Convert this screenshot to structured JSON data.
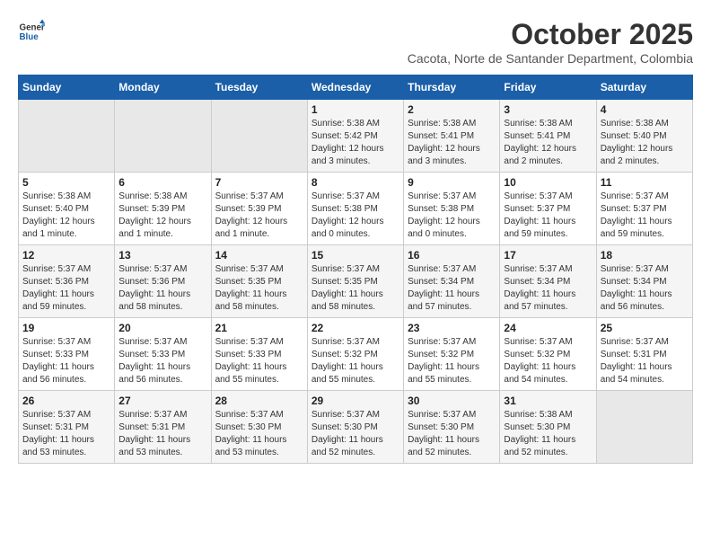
{
  "logo": {
    "general": "General",
    "blue": "Blue"
  },
  "header": {
    "month": "October 2025",
    "subtitle": "Cacota, Norte de Santander Department, Colombia"
  },
  "weekdays": [
    "Sunday",
    "Monday",
    "Tuesday",
    "Wednesday",
    "Thursday",
    "Friday",
    "Saturday"
  ],
  "weeks": [
    [
      {
        "day": "",
        "sunrise": "",
        "sunset": "",
        "daylight": ""
      },
      {
        "day": "",
        "sunrise": "",
        "sunset": "",
        "daylight": ""
      },
      {
        "day": "",
        "sunrise": "",
        "sunset": "",
        "daylight": ""
      },
      {
        "day": "1",
        "sunrise": "Sunrise: 5:38 AM",
        "sunset": "Sunset: 5:42 PM",
        "daylight": "Daylight: 12 hours and 3 minutes."
      },
      {
        "day": "2",
        "sunrise": "Sunrise: 5:38 AM",
        "sunset": "Sunset: 5:41 PM",
        "daylight": "Daylight: 12 hours and 3 minutes."
      },
      {
        "day": "3",
        "sunrise": "Sunrise: 5:38 AM",
        "sunset": "Sunset: 5:41 PM",
        "daylight": "Daylight: 12 hours and 2 minutes."
      },
      {
        "day": "4",
        "sunrise": "Sunrise: 5:38 AM",
        "sunset": "Sunset: 5:40 PM",
        "daylight": "Daylight: 12 hours and 2 minutes."
      }
    ],
    [
      {
        "day": "5",
        "sunrise": "Sunrise: 5:38 AM",
        "sunset": "Sunset: 5:40 PM",
        "daylight": "Daylight: 12 hours and 1 minute."
      },
      {
        "day": "6",
        "sunrise": "Sunrise: 5:38 AM",
        "sunset": "Sunset: 5:39 PM",
        "daylight": "Daylight: 12 hours and 1 minute."
      },
      {
        "day": "7",
        "sunrise": "Sunrise: 5:37 AM",
        "sunset": "Sunset: 5:39 PM",
        "daylight": "Daylight: 12 hours and 1 minute."
      },
      {
        "day": "8",
        "sunrise": "Sunrise: 5:37 AM",
        "sunset": "Sunset: 5:38 PM",
        "daylight": "Daylight: 12 hours and 0 minutes."
      },
      {
        "day": "9",
        "sunrise": "Sunrise: 5:37 AM",
        "sunset": "Sunset: 5:38 PM",
        "daylight": "Daylight: 12 hours and 0 minutes."
      },
      {
        "day": "10",
        "sunrise": "Sunrise: 5:37 AM",
        "sunset": "Sunset: 5:37 PM",
        "daylight": "Daylight: 11 hours and 59 minutes."
      },
      {
        "day": "11",
        "sunrise": "Sunrise: 5:37 AM",
        "sunset": "Sunset: 5:37 PM",
        "daylight": "Daylight: 11 hours and 59 minutes."
      }
    ],
    [
      {
        "day": "12",
        "sunrise": "Sunrise: 5:37 AM",
        "sunset": "Sunset: 5:36 PM",
        "daylight": "Daylight: 11 hours and 59 minutes."
      },
      {
        "day": "13",
        "sunrise": "Sunrise: 5:37 AM",
        "sunset": "Sunset: 5:36 PM",
        "daylight": "Daylight: 11 hours and 58 minutes."
      },
      {
        "day": "14",
        "sunrise": "Sunrise: 5:37 AM",
        "sunset": "Sunset: 5:35 PM",
        "daylight": "Daylight: 11 hours and 58 minutes."
      },
      {
        "day": "15",
        "sunrise": "Sunrise: 5:37 AM",
        "sunset": "Sunset: 5:35 PM",
        "daylight": "Daylight: 11 hours and 58 minutes."
      },
      {
        "day": "16",
        "sunrise": "Sunrise: 5:37 AM",
        "sunset": "Sunset: 5:34 PM",
        "daylight": "Daylight: 11 hours and 57 minutes."
      },
      {
        "day": "17",
        "sunrise": "Sunrise: 5:37 AM",
        "sunset": "Sunset: 5:34 PM",
        "daylight": "Daylight: 11 hours and 57 minutes."
      },
      {
        "day": "18",
        "sunrise": "Sunrise: 5:37 AM",
        "sunset": "Sunset: 5:34 PM",
        "daylight": "Daylight: 11 hours and 56 minutes."
      }
    ],
    [
      {
        "day": "19",
        "sunrise": "Sunrise: 5:37 AM",
        "sunset": "Sunset: 5:33 PM",
        "daylight": "Daylight: 11 hours and 56 minutes."
      },
      {
        "day": "20",
        "sunrise": "Sunrise: 5:37 AM",
        "sunset": "Sunset: 5:33 PM",
        "daylight": "Daylight: 11 hours and 56 minutes."
      },
      {
        "day": "21",
        "sunrise": "Sunrise: 5:37 AM",
        "sunset": "Sunset: 5:33 PM",
        "daylight": "Daylight: 11 hours and 55 minutes."
      },
      {
        "day": "22",
        "sunrise": "Sunrise: 5:37 AM",
        "sunset": "Sunset: 5:32 PM",
        "daylight": "Daylight: 11 hours and 55 minutes."
      },
      {
        "day": "23",
        "sunrise": "Sunrise: 5:37 AM",
        "sunset": "Sunset: 5:32 PM",
        "daylight": "Daylight: 11 hours and 55 minutes."
      },
      {
        "day": "24",
        "sunrise": "Sunrise: 5:37 AM",
        "sunset": "Sunset: 5:32 PM",
        "daylight": "Daylight: 11 hours and 54 minutes."
      },
      {
        "day": "25",
        "sunrise": "Sunrise: 5:37 AM",
        "sunset": "Sunset: 5:31 PM",
        "daylight": "Daylight: 11 hours and 54 minutes."
      }
    ],
    [
      {
        "day": "26",
        "sunrise": "Sunrise: 5:37 AM",
        "sunset": "Sunset: 5:31 PM",
        "daylight": "Daylight: 11 hours and 53 minutes."
      },
      {
        "day": "27",
        "sunrise": "Sunrise: 5:37 AM",
        "sunset": "Sunset: 5:31 PM",
        "daylight": "Daylight: 11 hours and 53 minutes."
      },
      {
        "day": "28",
        "sunrise": "Sunrise: 5:37 AM",
        "sunset": "Sunset: 5:30 PM",
        "daylight": "Daylight: 11 hours and 53 minutes."
      },
      {
        "day": "29",
        "sunrise": "Sunrise: 5:37 AM",
        "sunset": "Sunset: 5:30 PM",
        "daylight": "Daylight: 11 hours and 52 minutes."
      },
      {
        "day": "30",
        "sunrise": "Sunrise: 5:37 AM",
        "sunset": "Sunset: 5:30 PM",
        "daylight": "Daylight: 11 hours and 52 minutes."
      },
      {
        "day": "31",
        "sunrise": "Sunrise: 5:38 AM",
        "sunset": "Sunset: 5:30 PM",
        "daylight": "Daylight: 11 hours and 52 minutes."
      },
      {
        "day": "",
        "sunrise": "",
        "sunset": "",
        "daylight": ""
      }
    ]
  ]
}
